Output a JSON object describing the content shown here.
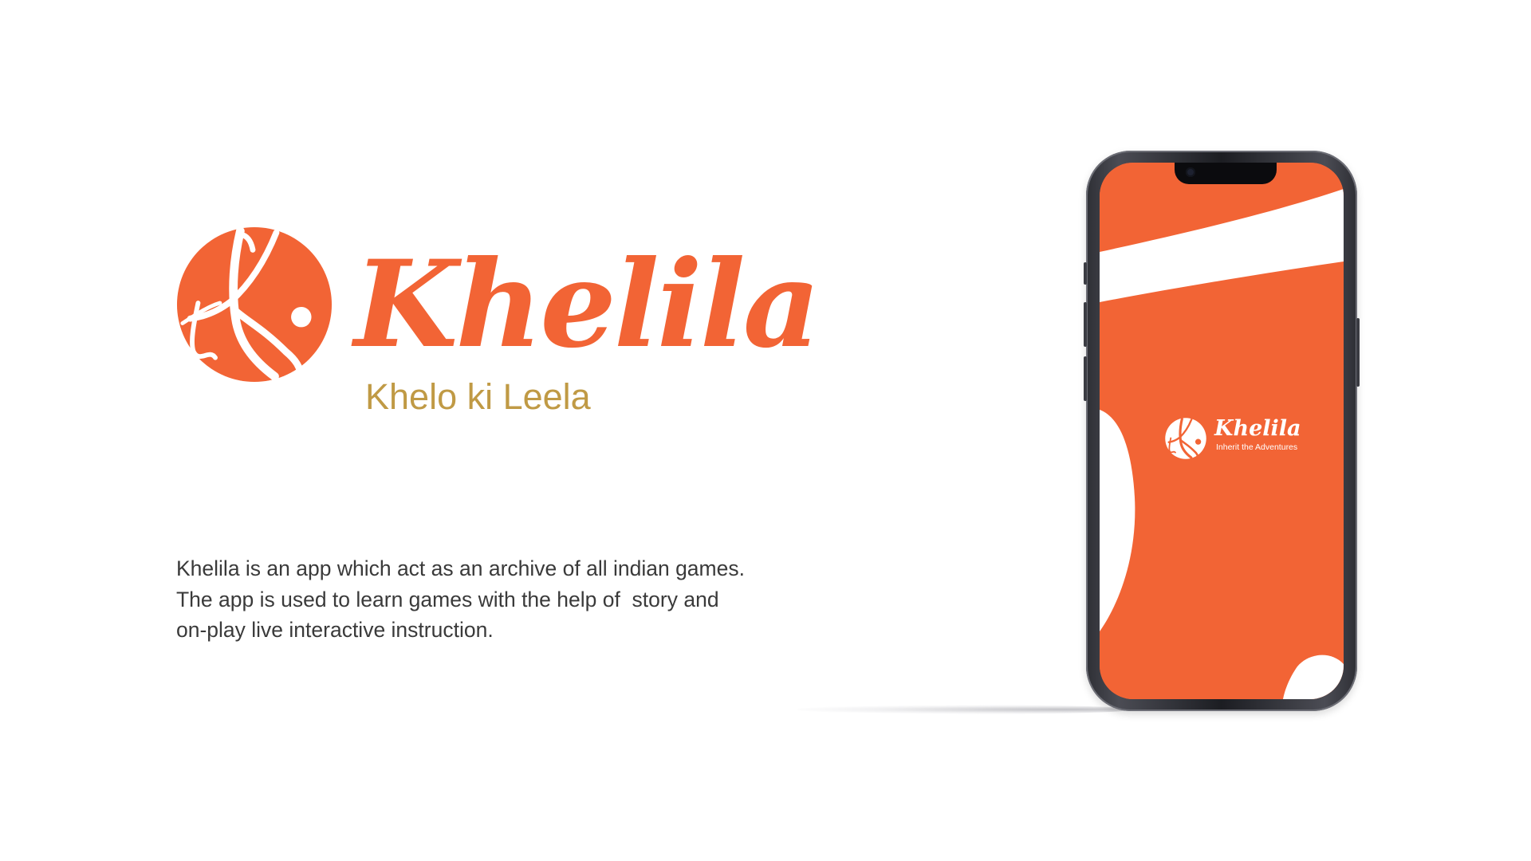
{
  "brand": {
    "name": "Khelila",
    "tagline": "Khelo ki Leela",
    "logo_icon": "khelila-k-mark-icon"
  },
  "description": {
    "lines": [
      "Khelila is an app which act as an archive of all indian games.",
      "The app is used to learn games with the help of  story and",
      "on-play live interactive instruction."
    ]
  },
  "phone": {
    "splash": {
      "app_name": "Khelila",
      "tagline": "Inherit the Adventures",
      "logo_icon": "khelila-k-mark-icon"
    }
  },
  "colors": {
    "brand_orange": "#f26435",
    "tagline_gold": "#c09a45",
    "description_text": "#3a3a3a",
    "background": "#ffffff",
    "phone_frame": "#2b2c32"
  }
}
